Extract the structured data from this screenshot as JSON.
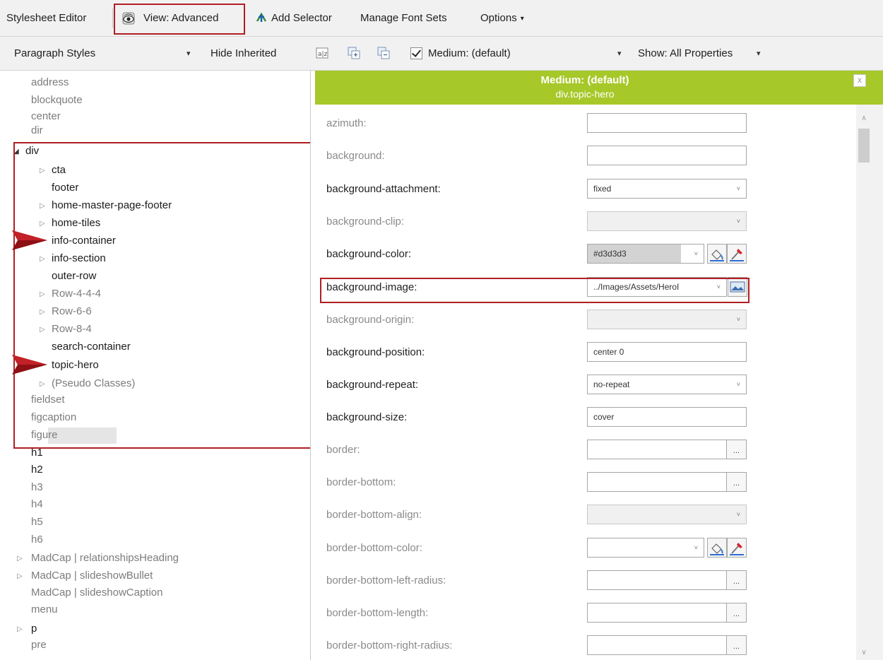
{
  "toolbar": {
    "title": "Stylesheet Editor",
    "view_label": "View: Advanced",
    "add_selector_label": "Add Selector",
    "manage_font_sets_label": "Manage Font Sets",
    "options_label": "Options",
    "options_caret": "▾"
  },
  "toolbar2": {
    "style_type": "Paragraph Styles",
    "hide_inherited_label": "Hide Inherited",
    "medium_label": "Medium: (default)",
    "show_label": "Show: All Properties",
    "dropdown_caret": "▾"
  },
  "tree": {
    "items": [
      {
        "label": "address",
        "style": "grey"
      },
      {
        "label": "blockquote",
        "style": "grey"
      },
      {
        "label": "center",
        "style": "grey"
      },
      {
        "label": "dir",
        "style": "grey"
      },
      {
        "label": "div",
        "style": "dark",
        "toggle": "◢"
      },
      {
        "label": "cta",
        "style": "dark",
        "toggle": "▷"
      },
      {
        "label": "footer",
        "style": "dark"
      },
      {
        "label": "home-master-page-footer",
        "style": "dark",
        "toggle": "▷"
      },
      {
        "label": "home-tiles",
        "style": "dark",
        "toggle": "▷"
      },
      {
        "label": "info-container",
        "style": "dark"
      },
      {
        "label": "info-section",
        "style": "dark",
        "toggle": "▷"
      },
      {
        "label": "outer-row",
        "style": "dark"
      },
      {
        "label": "Row-4-4-4",
        "style": "grey",
        "toggle": "▷"
      },
      {
        "label": "Row-6-6",
        "style": "grey",
        "toggle": "▷"
      },
      {
        "label": "Row-8-4",
        "style": "grey",
        "toggle": "▷"
      },
      {
        "label": "search-container",
        "style": "dark"
      },
      {
        "label": "topic-hero",
        "style": "dark"
      },
      {
        "label": "(Pseudo Classes)",
        "style": "grey",
        "toggle": "▷"
      },
      {
        "label": "fieldset",
        "style": "grey"
      },
      {
        "label": "figcaption",
        "style": "grey"
      },
      {
        "label": "figure",
        "style": "grey"
      },
      {
        "label": "h1",
        "style": "dark"
      },
      {
        "label": "h2",
        "style": "dark"
      },
      {
        "label": "h3",
        "style": "grey"
      },
      {
        "label": "h4",
        "style": "grey"
      },
      {
        "label": "h5",
        "style": "grey"
      },
      {
        "label": "h6",
        "style": "grey"
      },
      {
        "label": "MadCap | relationshipsHeading",
        "style": "grey",
        "toggle": "▷"
      },
      {
        "label": "MadCap | slideshowBullet",
        "style": "grey",
        "toggle": "▷"
      },
      {
        "label": "MadCap | slideshowCaption",
        "style": "grey"
      },
      {
        "label": "menu",
        "style": "grey"
      },
      {
        "label": "p",
        "style": "dark",
        "toggle": "▷"
      },
      {
        "label": "pre",
        "style": "grey"
      }
    ]
  },
  "panel": {
    "header_title": "Medium: (default)",
    "header_subtitle": "div.topic-hero",
    "close_label": "x"
  },
  "properties": [
    {
      "name": "azimuth:",
      "style": "grey",
      "value": "",
      "kind": "text"
    },
    {
      "name": "background:",
      "style": "grey",
      "value": "",
      "kind": "text"
    },
    {
      "name": "background-attachment:",
      "style": "dark",
      "value": "fixed",
      "kind": "select"
    },
    {
      "name": "background-clip:",
      "style": "grey",
      "value": "",
      "kind": "select-disabled"
    },
    {
      "name": "background-color:",
      "style": "dark",
      "value": "#d3d3d3",
      "kind": "color"
    },
    {
      "name": "background-image:",
      "style": "dark",
      "value": "../Images/Assets/HeroI",
      "kind": "image"
    },
    {
      "name": "background-origin:",
      "style": "grey",
      "value": "",
      "kind": "select-disabled"
    },
    {
      "name": "background-position:",
      "style": "dark",
      "value": "center 0",
      "kind": "text"
    },
    {
      "name": "background-repeat:",
      "style": "dark",
      "value": "no-repeat",
      "kind": "select"
    },
    {
      "name": "background-size:",
      "style": "dark",
      "value": "cover",
      "kind": "text"
    },
    {
      "name": "border:",
      "style": "grey",
      "value": "",
      "kind": "ellipsis"
    },
    {
      "name": "border-bottom:",
      "style": "grey",
      "value": "",
      "kind": "ellipsis"
    },
    {
      "name": "border-bottom-align:",
      "style": "grey",
      "value": "",
      "kind": "select-disabled"
    },
    {
      "name": "border-bottom-color:",
      "style": "grey",
      "value": "",
      "kind": "color-empty"
    },
    {
      "name": "border-bottom-left-radius:",
      "style": "grey",
      "value": "",
      "kind": "ellipsis"
    },
    {
      "name": "border-bottom-length:",
      "style": "grey",
      "value": "",
      "kind": "ellipsis"
    },
    {
      "name": "border-bottom-right-radius:",
      "style": "grey",
      "value": "",
      "kind": "ellipsis"
    }
  ],
  "field_controls": {
    "ellipsis": "...",
    "chevron": "˅"
  },
  "colors": {
    "header_green": "#a7c829",
    "annotation_red": "#b01e24",
    "swatch": "#d3d3d3"
  }
}
